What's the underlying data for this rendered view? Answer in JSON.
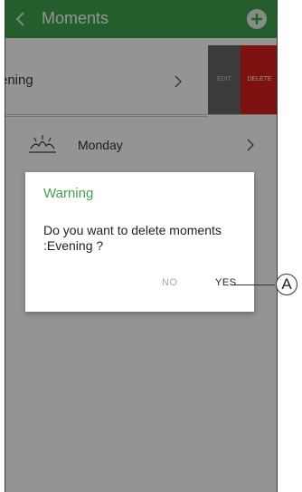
{
  "header": {
    "title": "Moments",
    "back_icon": "chevron-left-icon",
    "add_icon": "plus-circle-icon",
    "color": "#3fa34f"
  },
  "moment": {
    "name": "ening",
    "edit_label": "EDIT",
    "delete_label": "DELETE"
  },
  "schedule": {
    "day": "Monday",
    "icon": "sunrise-icon"
  },
  "dialog": {
    "title": "Warning",
    "message": "Do you want to delete moments :Evening ?",
    "no_label": "NO",
    "yes_label": "YES"
  },
  "callout": {
    "label": "A"
  }
}
